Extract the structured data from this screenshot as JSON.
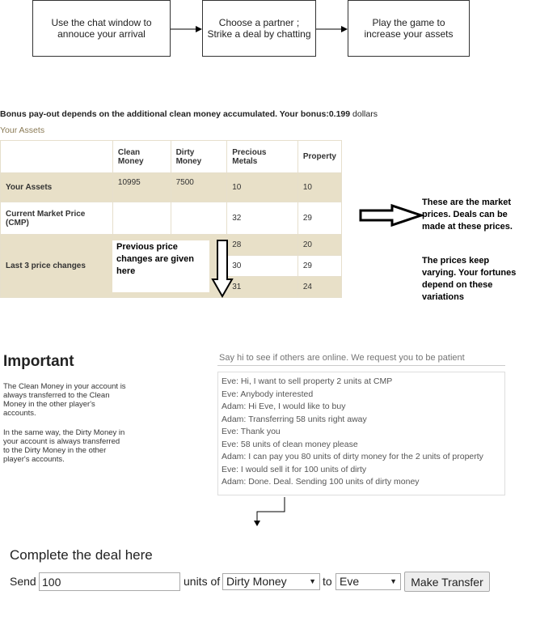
{
  "flow": {
    "step1": [
      "Use the chat window to",
      "annouce your arrival"
    ],
    "step2": [
      "Choose a partner ;",
      "Strike a deal by chatting"
    ],
    "step3": [
      "Play the game to",
      "increase your assets"
    ]
  },
  "bonus": {
    "label": "Bonus pay-out depends on the additional clean money accumulated. Your bonus:",
    "value": "0.199",
    "unit": "dollars"
  },
  "assets": {
    "section_label": "Your Assets",
    "headers": [
      "Clean Money",
      "Dirty Money",
      "Precious Metals",
      "Property"
    ],
    "your_assets": {
      "label": "Your Assets",
      "values": [
        "10995",
        "7500",
        "10",
        "10"
      ]
    },
    "cmp": {
      "label": "Current Market Price (CMP)",
      "values": [
        "",
        "",
        "32",
        "29"
      ]
    },
    "last3": {
      "label": "Last 3 price changes",
      "metals": [
        "28",
        "30",
        "31"
      ],
      "property": [
        "20",
        "29",
        "24"
      ]
    }
  },
  "annotations": {
    "prev_prices": "Previous price changes are given here",
    "market_note1": "These are the market prices. Deals can be made at these prices.",
    "market_note2": "The prices keep varying. Your fortunes depend on these variations"
  },
  "important": {
    "title": "Important",
    "para1": "The Clean Money in your account is always transferred to the Clean Money in the other player's accounts.",
    "para2": "In the same way, the Dirty Money in your account is always transferred to the Dirty Money in the other player's accounts."
  },
  "chat": {
    "placeholder": "Say hi to see if others are online. We request you to be patient",
    "messages": [
      "Eve: Hi, I want to sell property 2 units at CMP",
      "Eve: Anybody interested",
      "Adam: Hi Eve, I would like to buy",
      "Adam: Transferring 58 units right away",
      "Eve: Thank you",
      "Eve: 58 units of clean money please",
      "Adam: I can pay you 80 units of dirty money for the 2 units of property",
      "Eve: I would sell it for 100 units of dirty",
      "Adam: Done. Deal. Sending 100 units of dirty money"
    ]
  },
  "deal": {
    "title": "Complete the deal here",
    "send_label": "Send",
    "amount": "100",
    "units_of_label": "units of",
    "currency": "Dirty Money",
    "to_label": "to",
    "recipient": "Eve",
    "button": "Make Transfer"
  }
}
